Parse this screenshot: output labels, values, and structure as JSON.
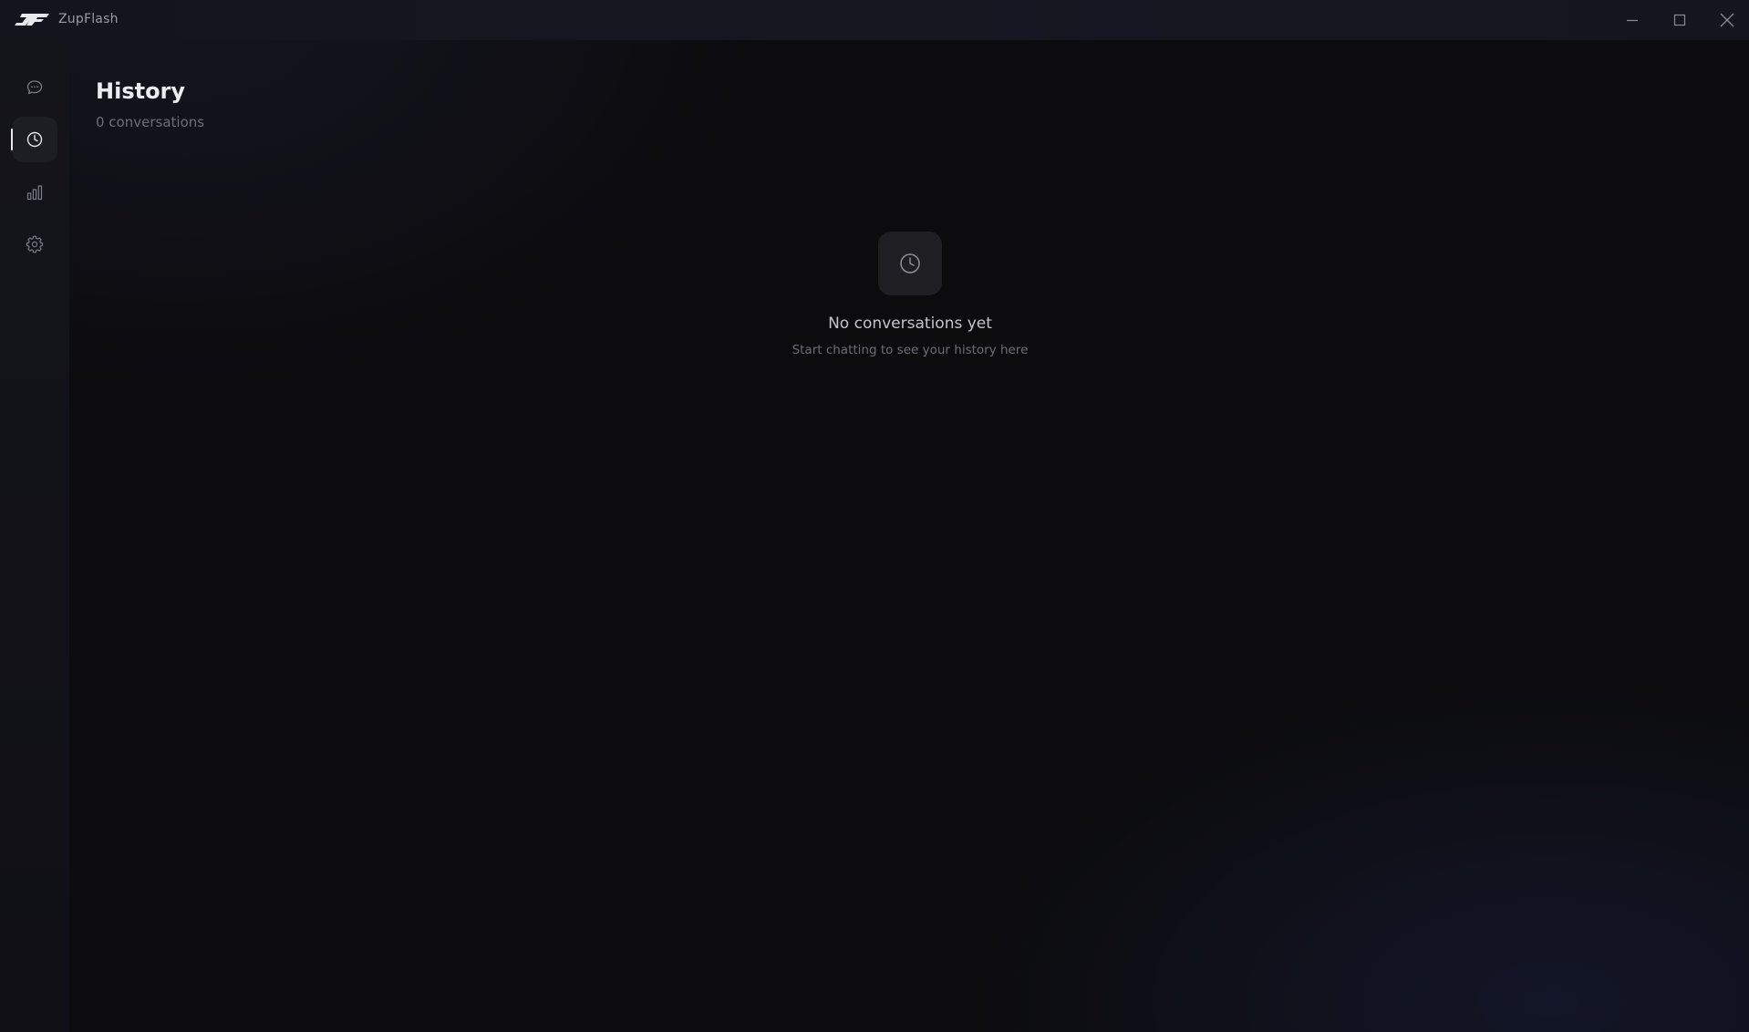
{
  "window": {
    "app_name": "ZupFlash"
  },
  "sidebar": {
    "items": [
      {
        "id": "chat",
        "icon": "chat-bubble-icon",
        "active": false
      },
      {
        "id": "history",
        "icon": "clock-icon",
        "active": true
      },
      {
        "id": "stats",
        "icon": "bar-chart-icon",
        "active": false
      },
      {
        "id": "settings",
        "icon": "gear-icon",
        "active": false
      }
    ]
  },
  "main": {
    "title": "History",
    "subtitle": "0 conversations",
    "empty_state": {
      "icon": "clock-icon",
      "title": "No conversations yet",
      "subtitle": "Start chatting to see your history here"
    }
  },
  "colors": {
    "background": "#0c0c0f",
    "sidebar": "#14141b",
    "active_nav": "#1d1d24",
    "text_primary": "#ececf0",
    "text_muted": "#6e6e78"
  }
}
